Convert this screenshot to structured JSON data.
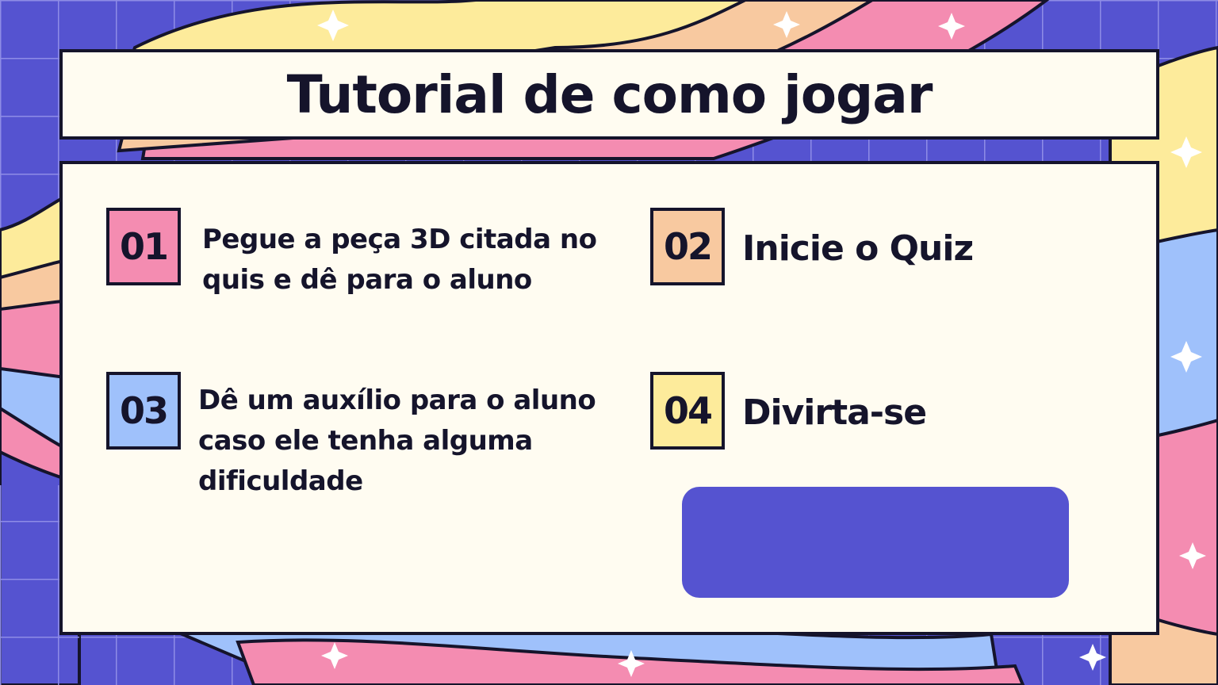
{
  "title": "Tutorial de como jogar",
  "colors": {
    "background": "#5553d0",
    "panel": "#fffcf1",
    "outline": "#15142b",
    "yellow": "#fdeb9b",
    "peach": "#f8c9a0",
    "pink": "#f48cb1",
    "blue": "#9fc1fb",
    "button": "#5553d0"
  },
  "steps": [
    {
      "number": "01",
      "text": "Pegue a peça 3D citada no quis e dê para o aluno",
      "color": "#f48cb1"
    },
    {
      "number": "02",
      "text": "Inicie o Quiz",
      "color": "#f8c9a0"
    },
    {
      "number": "03",
      "text": "Dê um auxílio para o aluno caso ele tenha alguma dificuldade",
      "color": "#9fc1fb"
    },
    {
      "number": "04",
      "text": "Divirta-se",
      "color": "#fdeb9b"
    }
  ],
  "button": {
    "label": ""
  }
}
